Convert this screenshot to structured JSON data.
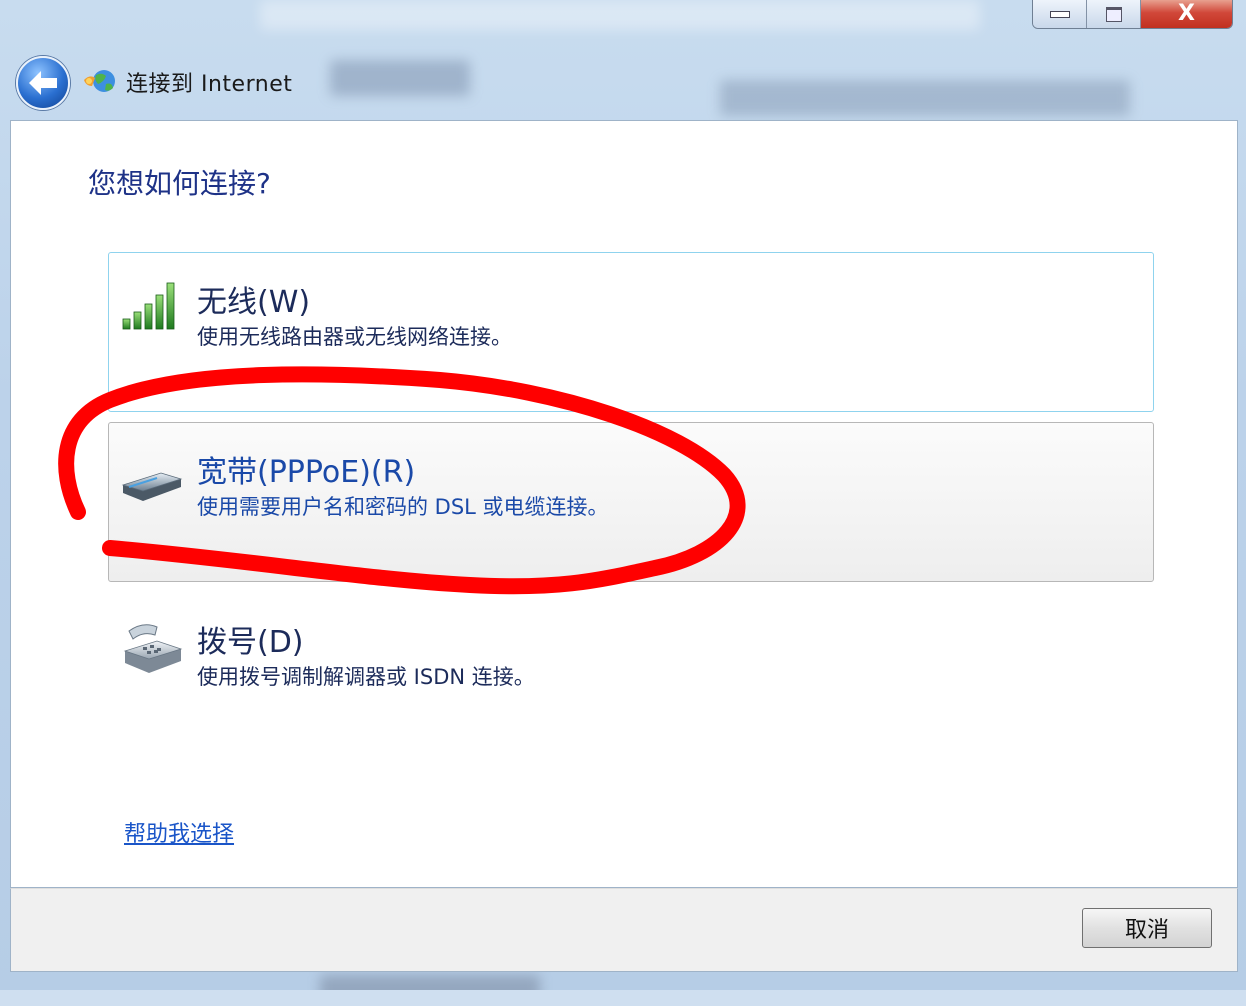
{
  "window": {
    "title": "连接到 Internet",
    "caption_buttons": [
      "minimize-icon",
      "maximize-icon",
      "close-icon"
    ],
    "close_glyph": "X"
  },
  "main": {
    "question": "您想如何连接?",
    "options": [
      {
        "icon": "signal-bars-icon",
        "title": "无线(W)",
        "description": "使用无线路由器或无线网络连接。"
      },
      {
        "icon": "broadband-modem-icon",
        "title": "宽带(PPPoE)(R)",
        "description": "使用需要用户名和密码的 DSL 或电缆连接。"
      },
      {
        "icon": "telephone-icon",
        "title": "拨号(D)",
        "description": "使用拨号调制解调器或 ISDN 连接。"
      }
    ],
    "help_link": "帮助我选择"
  },
  "footer": {
    "cancel_label": "取消"
  },
  "colors": {
    "heading": "#1e3287",
    "link": "#1a55c8",
    "selected_border": "#8fd3ee",
    "annotation_red": "#ff0000"
  }
}
